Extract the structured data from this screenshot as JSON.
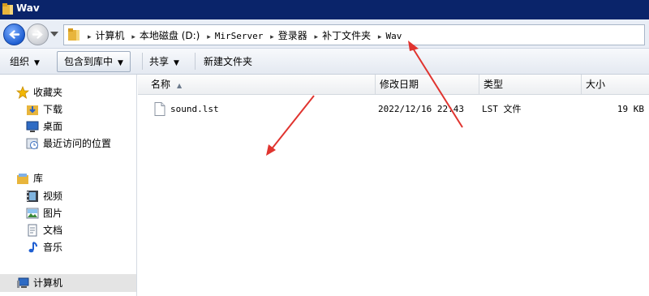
{
  "window": {
    "title": "Wav"
  },
  "address": {
    "crumbs": [
      "计算机",
      "本地磁盘 (D:)",
      "MirServer",
      "登录器",
      "补丁文件夹",
      "Wav"
    ]
  },
  "toolbar": {
    "organize": "组织",
    "include_in_library": "包含到库中",
    "share": "共享",
    "new_folder": "新建文件夹"
  },
  "sidebar": {
    "favorites": "收藏夹",
    "downloads": "下载",
    "desktop": "桌面",
    "recent": "最近访问的位置",
    "libraries": "库",
    "videos": "视频",
    "pictures": "图片",
    "documents": "文档",
    "music": "音乐",
    "computer": "计算机"
  },
  "columns": {
    "name": "名称",
    "modified": "修改日期",
    "type": "类型",
    "size": "大小"
  },
  "files": [
    {
      "name": "sound.lst",
      "modified": "2022/12/16 22:43",
      "type": "LST 文件",
      "size": "19 KB"
    }
  ],
  "colors": {
    "title_bar": "#0a246a",
    "annotation_arrow": "#e0342f"
  }
}
